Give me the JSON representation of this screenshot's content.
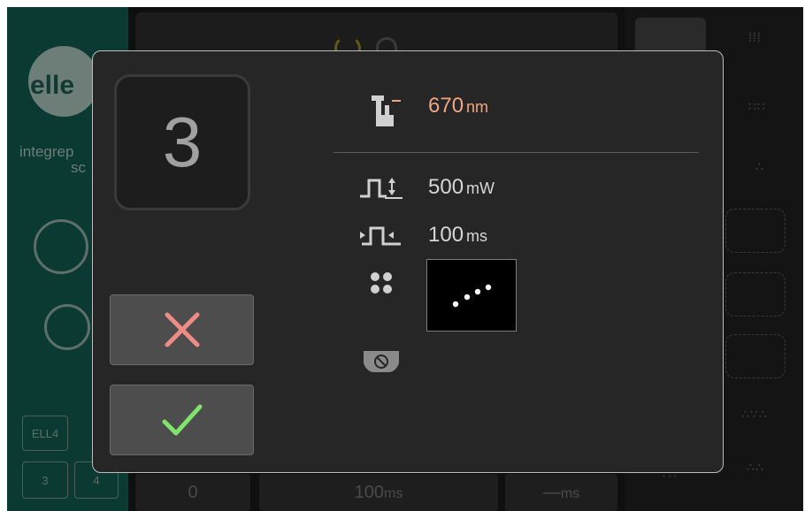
{
  "background": {
    "brand": {
      "logo_text": "elle",
      "line1": "integrep",
      "line2": "sc"
    },
    "sidebar_buttons": [
      "ELL4",
      "3",
      "4"
    ],
    "bottom_values": {
      "count": "0",
      "duration_value": "100",
      "duration_unit": "ms",
      "interval_value": "—",
      "interval_unit": "ms"
    }
  },
  "dialog": {
    "step_number": "3",
    "wavelength": {
      "value": "670",
      "unit": "nm"
    },
    "power": {
      "value": "500",
      "unit": "mW"
    },
    "duration": {
      "value": "100",
      "unit": "ms"
    },
    "pattern": {
      "label": "spot pattern",
      "spots": 4
    },
    "buttons": {
      "cancel_icon": "x-icon",
      "confirm_icon": "check-icon"
    },
    "colors": {
      "wavelength": "#f2a482",
      "cancel": "#f08a85",
      "confirm": "#7ee46a",
      "text": "#d6d6d6"
    }
  },
  "icons": [
    "laser-aiming-icon",
    "power-pulse-icon",
    "duration-pulse-icon",
    "spot-pattern-icon",
    "no-eye-icon"
  ]
}
